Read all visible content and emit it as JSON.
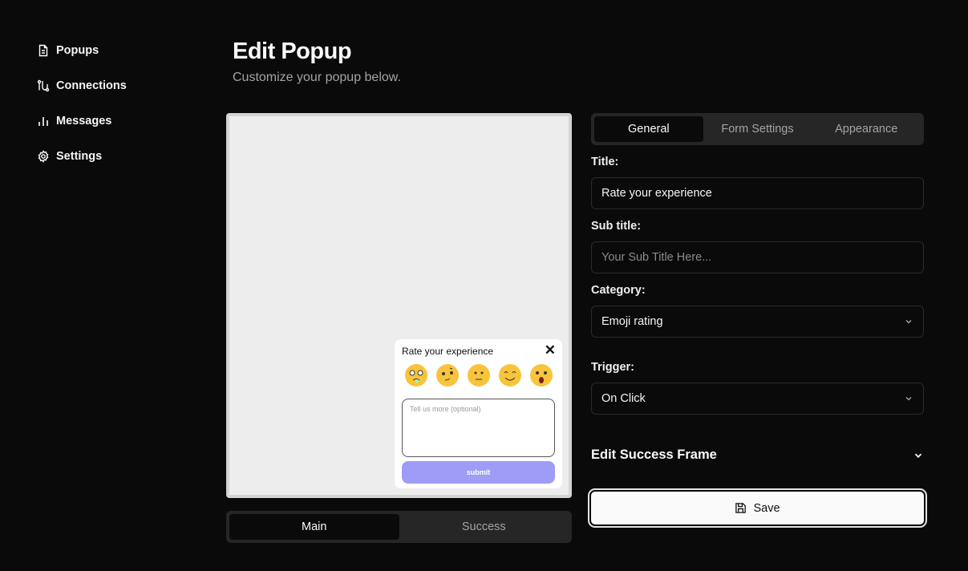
{
  "sidebar": {
    "items": [
      {
        "label": "Popups",
        "icon": "file-text-icon"
      },
      {
        "label": "Connections",
        "icon": "route-icon"
      },
      {
        "label": "Messages",
        "icon": "bar-chart-icon"
      },
      {
        "label": "Settings",
        "icon": "gear-icon"
      }
    ]
  },
  "header": {
    "title": "Edit Popup",
    "subtitle": "Customize your popup below."
  },
  "preview": {
    "popup_title": "Rate your experience",
    "textarea_placeholder": "Tell us more (optional)",
    "submit_label": "submit",
    "submit_color": "#9e9cf6",
    "emojis": [
      "crying-face",
      "smirk-face",
      "neutral-face",
      "smiling-face",
      "shocked-face"
    ],
    "tabs": [
      "Main",
      "Success"
    ],
    "active_tab": "Main"
  },
  "form": {
    "tabs": [
      "General",
      "Form Settings",
      "Appearance"
    ],
    "active_tab": "General",
    "title_label": "Title:",
    "title_value": "Rate your experience",
    "subtitle_label": "Sub title:",
    "subtitle_placeholder": "Your Sub Title Here...",
    "category_label": "Category:",
    "category_value": "Emoji rating",
    "trigger_label": "Trigger:",
    "trigger_value": "On Click",
    "success_frame_label": "Edit Success Frame",
    "save_label": "Save"
  }
}
